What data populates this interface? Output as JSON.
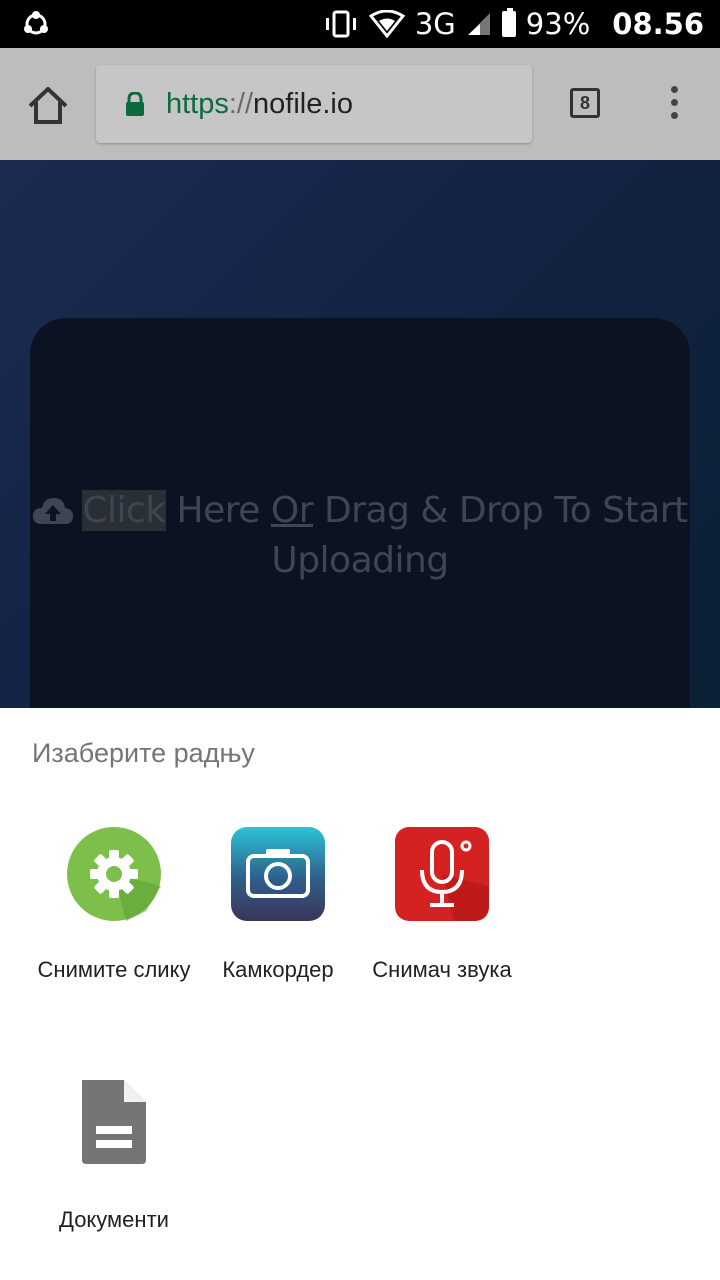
{
  "status_bar": {
    "network": "3G",
    "battery": "93%",
    "time": "08.56"
  },
  "browser": {
    "url_scheme": "https",
    "url_separator": "://",
    "url_host": "nofile.io",
    "tab_count": "8"
  },
  "page": {
    "drop_click": "Click",
    "drop_here": " Here ",
    "drop_or": "Or",
    "drop_rest": " Drag & Drop To Start Uploading"
  },
  "chooser": {
    "title": "Изаберите радњу",
    "apps": [
      {
        "label": "Снимите слику",
        "icon": "camera-settings-icon",
        "color": "#7cc04b"
      },
      {
        "label": "Камкордер",
        "icon": "camera-icon",
        "color": "#2aa8c8"
      },
      {
        "label": "Снимач звука",
        "icon": "microphone-icon",
        "color": "#d42222"
      },
      {
        "label": "Документи",
        "icon": "document-icon",
        "color": "#757575"
      }
    ]
  }
}
